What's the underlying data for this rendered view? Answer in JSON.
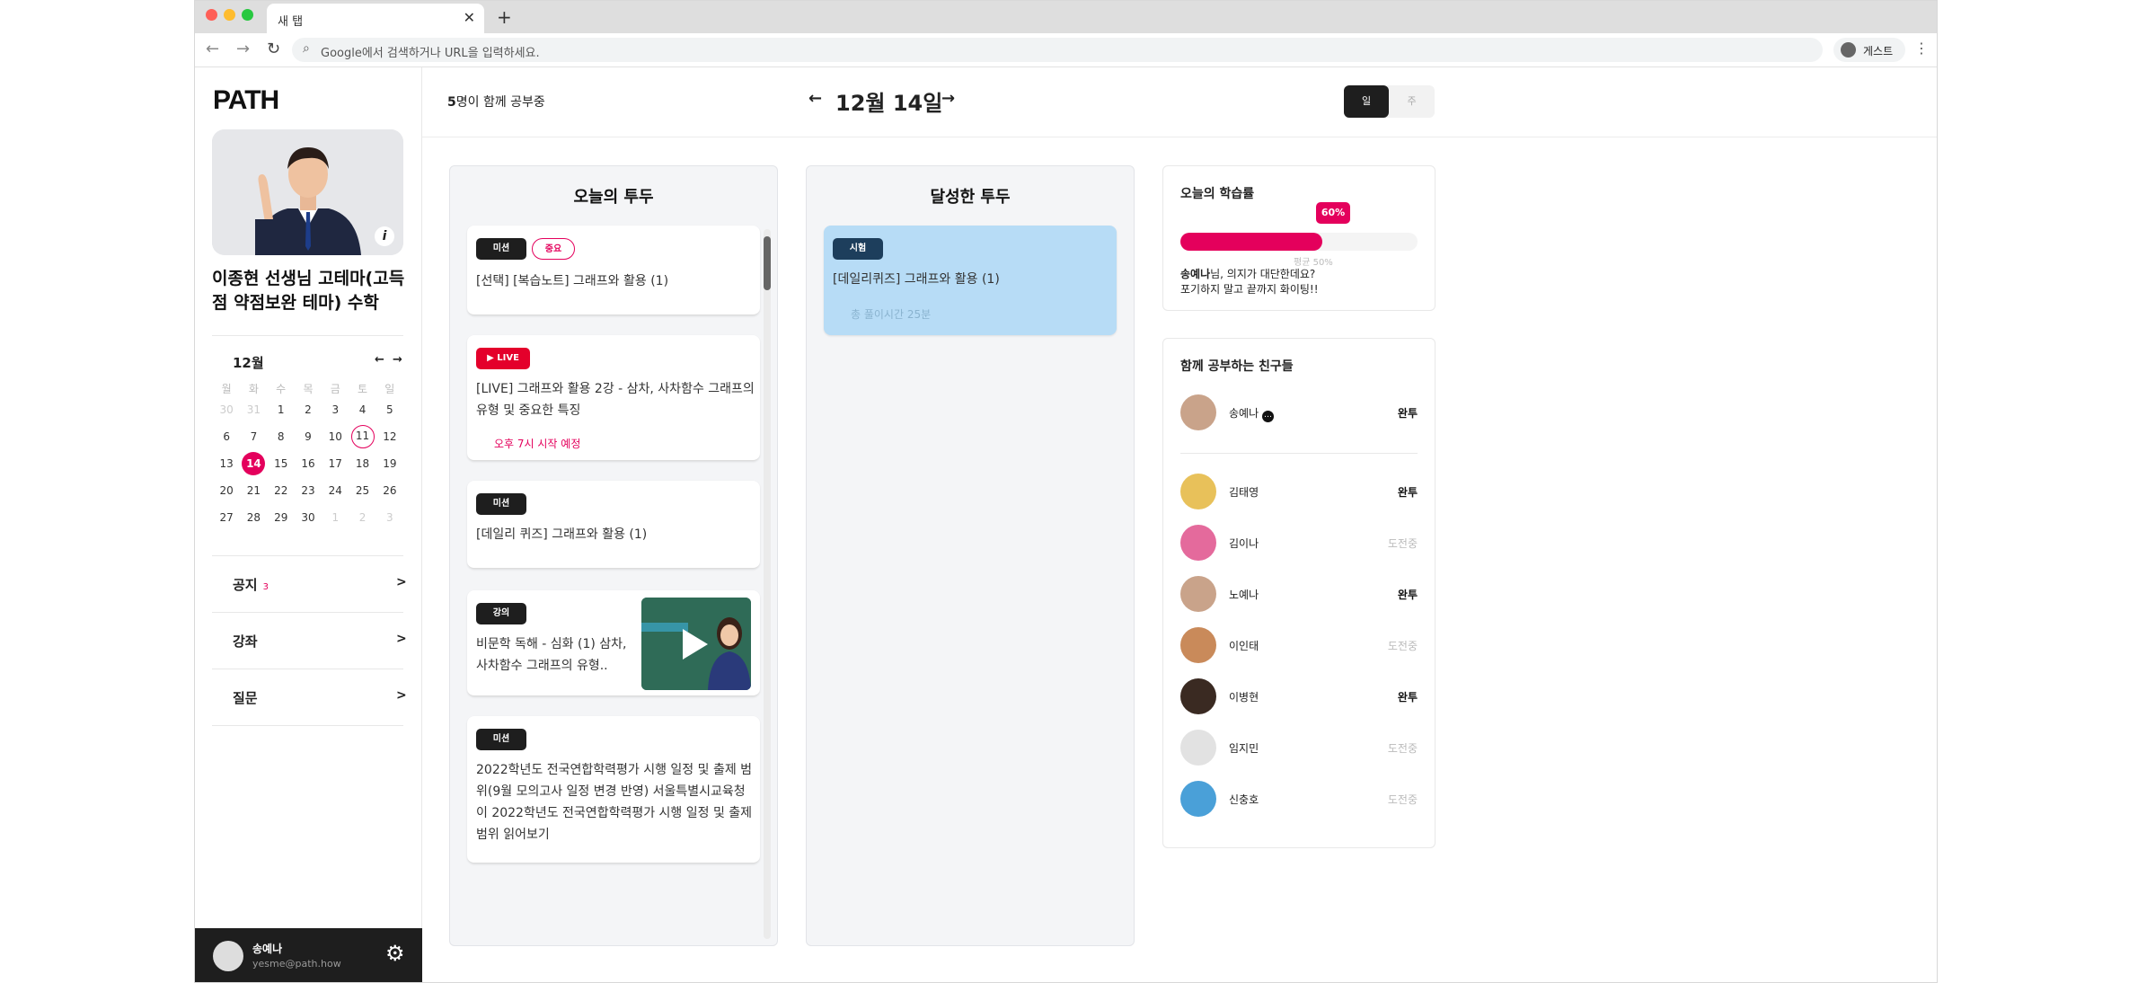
{
  "browser": {
    "tab_title": "새 탭",
    "tab_close": "✕",
    "new_tab": "+",
    "back": "←",
    "forward": "→",
    "reload": "↻",
    "search_icon": "🔍",
    "address_placeholder": "Google에서 검색하거나 URL을 입력하세요.",
    "profile_label": "게스트",
    "menu": "⋮"
  },
  "sidebar": {
    "logo": "PATH",
    "info_icon": "i",
    "course_title": "이종현 선생님 고테마(고득점 약점보완 테마) 수학",
    "calendar": {
      "month": "12월",
      "prev": "←",
      "next": "→",
      "weekdays": [
        "월",
        "화",
        "수",
        "목",
        "금",
        "토",
        "일"
      ],
      "weeks": [
        [
          "30",
          "31",
          "1",
          "2",
          "3",
          "4",
          "5"
        ],
        [
          "6",
          "7",
          "8",
          "9",
          "10",
          "11",
          "12"
        ],
        [
          "13",
          "14",
          "15",
          "16",
          "17",
          "18",
          "19"
        ],
        [
          "20",
          "21",
          "22",
          "23",
          "24",
          "25",
          "26"
        ],
        [
          "27",
          "28",
          "29",
          "30",
          "1",
          "2",
          "3"
        ]
      ],
      "selected": "14",
      "today": "11"
    },
    "menu": [
      {
        "label": "공지",
        "badge": "3"
      },
      {
        "label": "강좌",
        "badge": ""
      },
      {
        "label": "질문",
        "badge": ""
      }
    ],
    "user": {
      "name": "송예나",
      "email": "yesme@path.how"
    }
  },
  "topbar": {
    "count_num": "5",
    "count_text": "명이 함께 공부중",
    "date": "12월 14일",
    "prev": "←",
    "next": "→",
    "view_day": "일",
    "view_week": "주"
  },
  "todo": {
    "title": "오늘의 투두",
    "cards": [
      {
        "tags": [
          "미션",
          "중요"
        ],
        "text": "[선택] [복습노트] 그래프와 활용 (1)"
      },
      {
        "tags": [
          "LIVE"
        ],
        "text": "[LIVE] 그래프와 활용 2강 - 삼차, 사차함수 그래프의 유형 및 중요한 특징",
        "sub": "오후 7시 시작 예정"
      },
      {
        "tags": [
          "미션"
        ],
        "text": "[데일리 퀴즈] 그래프와 활용 (1)"
      },
      {
        "tags": [
          "강의"
        ],
        "text": "비문학 독해 - 심화 (1) 삼차, 사차함수 그래프의 유형.."
      },
      {
        "tags": [
          "미션"
        ],
        "text": "2022학년도 전국연합학력평가 시행 일정 및 출제 범위(9월 모의고사 일정 변경 반영) 서울특별시교육청이 2022학년도 전국연합학력평가 시행 일정 및 출제 범위 읽어보기"
      }
    ]
  },
  "done": {
    "title": "달성한 투두",
    "cards": [
      {
        "tag": "시험",
        "text": "[데일리퀴즈] 그래프와 활용 (1)",
        "sub": "총 풀이시간 25분"
      }
    ]
  },
  "rate": {
    "title": "오늘의 학습률",
    "percent": "60%",
    "percent_value": 0.6,
    "avg": "평균 50%",
    "msg_name": "송예나",
    "msg_line1": "님, 의지가 대단한데요?",
    "msg_line2": "포기하지 말고 끝까지 화이팅!!"
  },
  "friends": {
    "title": "함께 공부하는 친구들",
    "me": {
      "name": "송예나",
      "status": "완투"
    },
    "list": [
      {
        "name": "김태영",
        "status": "완투"
      },
      {
        "name": "김이나",
        "status": "도전중"
      },
      {
        "name": "노예나",
        "status": "완투"
      },
      {
        "name": "이인태",
        "status": "도전중"
      },
      {
        "name": "이병현",
        "status": "완투"
      },
      {
        "name": "임지민",
        "status": "도전중"
      },
      {
        "name": "신충호",
        "status": "도전중"
      }
    ]
  },
  "colors": {
    "accent": "#e4005c",
    "dark": "#1e1e1e",
    "done_card": "#b7dcf6"
  }
}
